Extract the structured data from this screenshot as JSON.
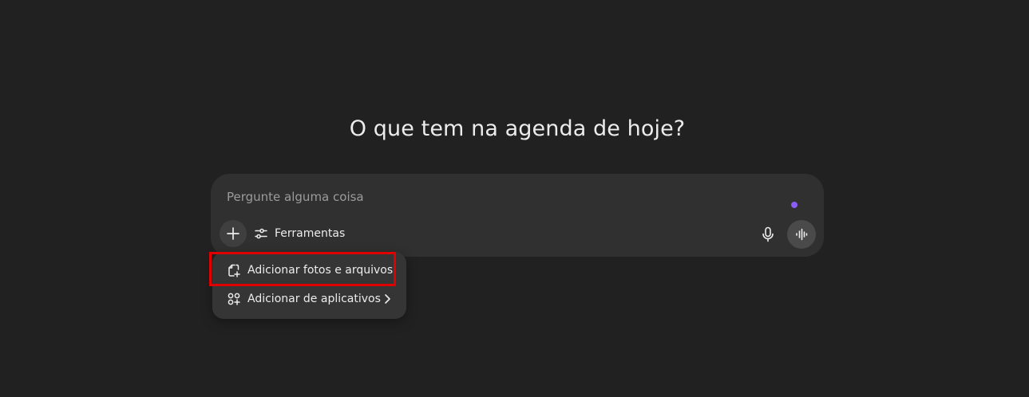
{
  "headline": "O que tem na agenda de hoje?",
  "composer": {
    "placeholder": "Pergunte alguma coisa",
    "value": "",
    "add_icon": "plus-icon",
    "tools_label": "Ferramentas",
    "tools_icon": "sliders-icon",
    "mic_icon": "microphone-icon",
    "voice_icon": "voice-waveform-icon",
    "status_dot_color": "#8b5cf6"
  },
  "attach_menu": {
    "items": [
      {
        "label": "Adicionar fotos e arquivos",
        "icon": "add-file-icon",
        "highlighted": true
      },
      {
        "label": "Adicionar de aplicativos",
        "icon": "apps-grid-icon",
        "has_submenu": true
      }
    ]
  },
  "colors": {
    "background": "#212121",
    "composer": "#303030",
    "menu": "#353535",
    "highlight_border": "#e00000"
  }
}
